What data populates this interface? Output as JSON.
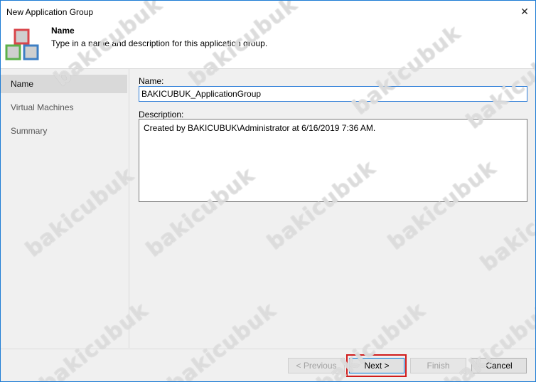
{
  "window": {
    "title": "New Application Group",
    "close_glyph": "✕"
  },
  "header": {
    "title": "Name",
    "subtitle": "Type in a name and description for this application group."
  },
  "sidebar": {
    "items": [
      {
        "label": "Name",
        "active": true
      },
      {
        "label": "Virtual Machines",
        "active": false
      },
      {
        "label": "Summary",
        "active": false
      }
    ]
  },
  "form": {
    "name_label": "Name:",
    "name_value": "BAKICUBUK_ApplicationGroup",
    "description_label": "Description:",
    "description_value": "Created by BAKICUBUK\\Administrator at 6/16/2019 7:36 AM."
  },
  "footer": {
    "previous_label": "< Previous",
    "next_label": "Next >",
    "finish_label": "Finish",
    "cancel_label": "Cancel"
  },
  "watermark": {
    "text": "bakicubuk"
  },
  "colors": {
    "accent": "#0078d7",
    "highlight": "#d01c1c",
    "logo_red": "#d9454a",
    "logo_green": "#5bb04a",
    "logo_blue": "#3e7fc4"
  }
}
